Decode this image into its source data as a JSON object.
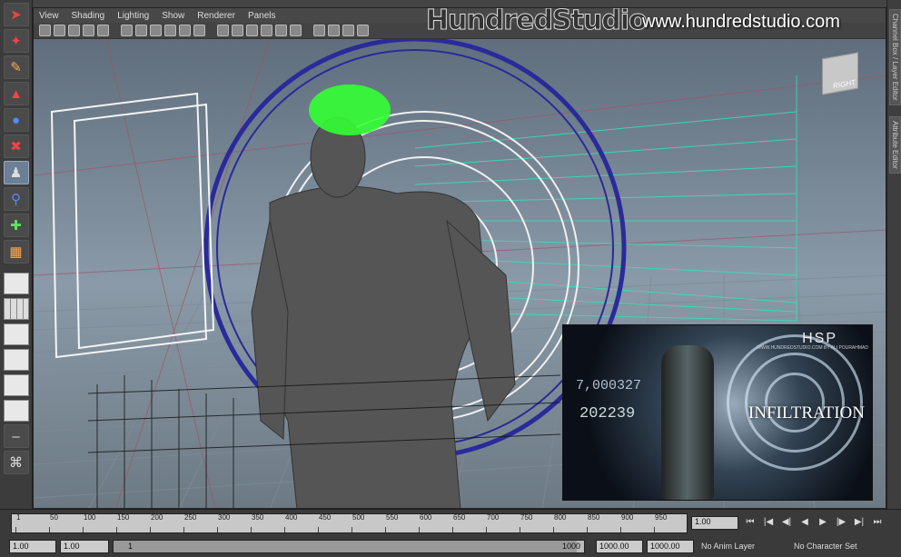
{
  "menu": [
    "View",
    "Shading",
    "Lighting",
    "Show",
    "Renderer",
    "Panels"
  ],
  "brand": "HundredStudio",
  "url": "www.hundredstudio.com",
  "viewcube_label": "RIGHT",
  "side_tabs": [
    "Channel Box / Layer Editor",
    "Attribute Editor"
  ],
  "poster": {
    "logo": "HSP",
    "logo_sub": "WWW.HUNDREDSTUDIO.COM  BY ALI POURAHMAD",
    "title": "INFILTRATION",
    "num1": "7,000327",
    "num2": "202239"
  },
  "timeline": {
    "ticks": [
      "1",
      "50",
      "100",
      "150",
      "200",
      "250",
      "300",
      "350",
      "400",
      "450",
      "500",
      "550",
      "600",
      "650",
      "700",
      "750",
      "800",
      "850",
      "900",
      "950"
    ],
    "current_frame": "1.00"
  },
  "range": {
    "start": "1.00",
    "start2": "1.00",
    "slider_start": "1",
    "slider_end": "1000",
    "end": "1000.00",
    "end2": "1000.00",
    "anim_layer": "No Anim Layer",
    "char_set": "No Character Set"
  },
  "colors": {
    "hair": "#33ff33",
    "accent": "#2a2a9a"
  }
}
